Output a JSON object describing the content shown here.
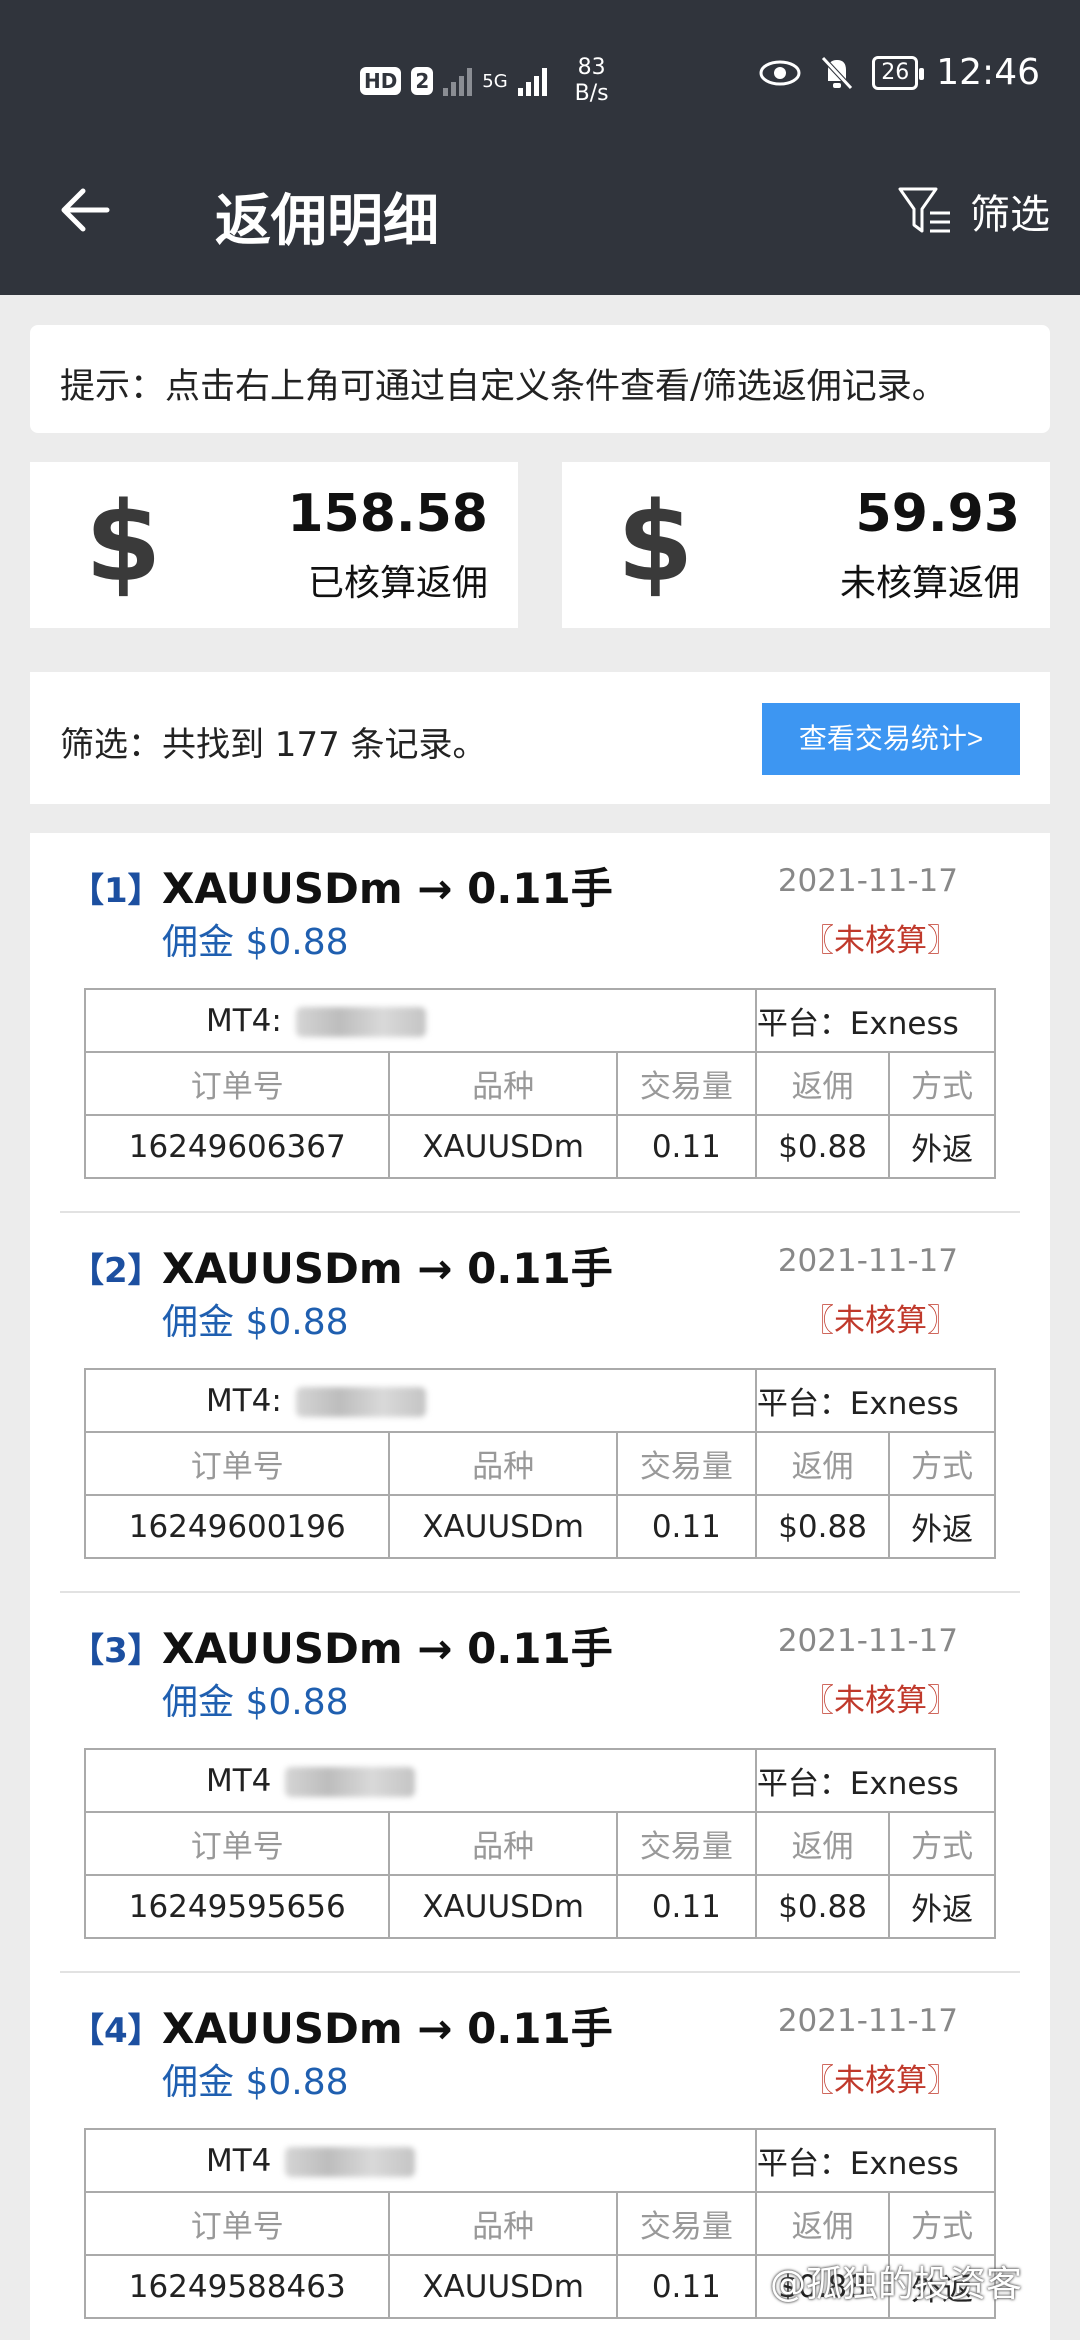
{
  "status_bar": {
    "hd": "HD",
    "sim": "2",
    "net": "5G",
    "speed_value": "83",
    "speed_unit": "B/s",
    "battery": "26",
    "time": "12:46"
  },
  "header": {
    "title": "返佣明细",
    "filter_label": "筛选"
  },
  "tip": "提示：点击右上角可通过自定义条件查看/筛选返佣记录。",
  "stats": [
    {
      "symbol": "$",
      "value": "158.58",
      "label": "已核算返佣"
    },
    {
      "symbol": "$",
      "value": "59.93",
      "label": "未核算返佣"
    }
  ],
  "summary": {
    "text": "筛选：共找到 177 条记录。",
    "button_label": "查看交易统计>"
  },
  "table_headers": [
    "订单号",
    "品种",
    "交易量",
    "返佣",
    "方式"
  ],
  "records": [
    {
      "index": "【1】",
      "title": "XAUUSDm → 0.11手",
      "date": "2021-11-17",
      "commission": "佣金 $0.88",
      "status": "〖未核算〗",
      "mt4": "MT4:",
      "platform": "平台：Exness",
      "order": "16249606367",
      "symbol": "XAUUSDm",
      "volume": "0.11",
      "rebate": "$0.88",
      "method": "外返"
    },
    {
      "index": "【2】",
      "title": "XAUUSDm → 0.11手",
      "date": "2021-11-17",
      "commission": "佣金 $0.88",
      "status": "〖未核算〗",
      "mt4": "MT4:",
      "platform": "平台：Exness",
      "order": "16249600196",
      "symbol": "XAUUSDm",
      "volume": "0.11",
      "rebate": "$0.88",
      "method": "外返"
    },
    {
      "index": "【3】",
      "title": "XAUUSDm → 0.11手",
      "date": "2021-11-17",
      "commission": "佣金 $0.88",
      "status": "〖未核算〗",
      "mt4": "MT4",
      "platform": "平台：Exness",
      "order": "16249595656",
      "symbol": "XAUUSDm",
      "volume": "0.11",
      "rebate": "$0.88",
      "method": "外返"
    },
    {
      "index": "【4】",
      "title": "XAUUSDm → 0.11手",
      "date": "2021-11-17",
      "commission": "佣金 $0.88",
      "status": "〖未核算〗",
      "mt4": "MT4",
      "platform": "平台：Exness",
      "order": "16249588463",
      "symbol": "XAUUSDm",
      "volume": "0.11",
      "rebate": "$0.88",
      "method": "外返"
    }
  ],
  "watermark": "@孤独的投资客"
}
